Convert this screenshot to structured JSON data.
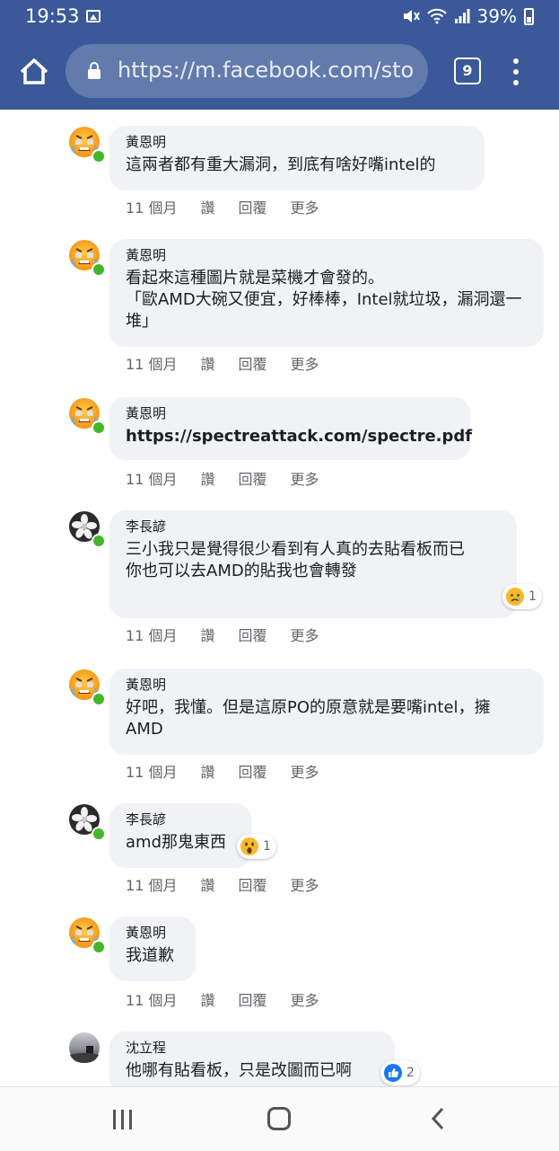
{
  "status_bar": {
    "time": "19:53",
    "battery": "39%",
    "icons": [
      "image-icon",
      "mute-icon",
      "wifi-icon",
      "signal-icon",
      "battery-icon"
    ]
  },
  "browser": {
    "url": "https://m.facebook.com/sto",
    "tab_count": "9",
    "icons": [
      "home-icon",
      "lock-icon",
      "tabs-icon",
      "more-vert-icon"
    ]
  },
  "comments": [
    {
      "author": "黃恩明",
      "text": "這兩者都有重大漏洞，到底有啥好嘴intel的",
      "time": "11 個月",
      "like": "讚",
      "reply": "回覆",
      "more": "更多",
      "avatar": "angry-emoji-avatar"
    },
    {
      "author": "黃恩明",
      "text": "看起來這種圖片就是菜機才會發的。\n「歐AMD大碗又便宜，好棒棒，Intel就垃圾，漏洞還一堆」",
      "time": "11 個月",
      "like": "讚",
      "reply": "回覆",
      "more": "更多",
      "avatar": "angry-emoji-avatar"
    },
    {
      "author": "黃恩明",
      "text": "https://spectreattack.com/spectre.pdf",
      "time": "11 個月",
      "like": "讚",
      "reply": "回覆",
      "more": "更多",
      "avatar": "angry-emoji-avatar"
    },
    {
      "author": "李長諺",
      "text": "三小我只是覺得很少看到有人真的去貼看板而已\n你也可以去AMD的貼我也會轉發",
      "time": "11 個月",
      "like": "讚",
      "reply": "回覆",
      "more": "更多",
      "avatar": "flower-avatar",
      "reaction": {
        "type": "sad",
        "count": "1"
      }
    },
    {
      "author": "黃恩明",
      "text": "好吧，我懂。但是這原PO的原意就是要嘴intel，擁AMD",
      "time": "11 個月",
      "like": "讚",
      "reply": "回覆",
      "more": "更多",
      "avatar": "angry-emoji-avatar"
    },
    {
      "author": "李長諺",
      "text": "amd那鬼東西",
      "time": "11 個月",
      "like": "讚",
      "reply": "回覆",
      "more": "更多",
      "avatar": "flower-avatar",
      "reaction": {
        "type": "wow",
        "count": "1"
      }
    },
    {
      "author": "黃恩明",
      "text": "我道歉",
      "time": "11 個月",
      "like": "讚",
      "reply": "回覆",
      "more": "更多",
      "avatar": "angry-emoji-avatar"
    },
    {
      "author": "沈立程",
      "text": "他哪有貼看板，只是改圖而已啊",
      "avatar": "photo-avatar",
      "reaction": {
        "type": "like",
        "count": "2"
      }
    }
  ],
  "colors": {
    "header": "#3b5998",
    "bubble": "#f0f2f5",
    "meta_text": "#65676b",
    "online": "#42b72a",
    "like_blue": "#1877f2"
  }
}
